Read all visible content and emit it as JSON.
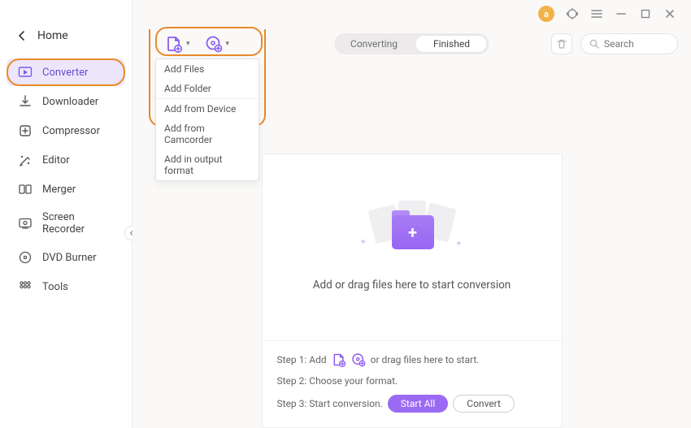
{
  "header": {
    "home_label": "Home",
    "avatar_initial": "a"
  },
  "sidebar": {
    "items": [
      {
        "label": "Converter"
      },
      {
        "label": "Downloader"
      },
      {
        "label": "Compressor"
      },
      {
        "label": "Editor"
      },
      {
        "label": "Merger"
      },
      {
        "label": "Screen Recorder"
      },
      {
        "label": "DVD Burner"
      },
      {
        "label": "Tools"
      }
    ]
  },
  "toolbar": {
    "tabs": {
      "converting": "Converting",
      "finished": "Finished"
    },
    "search_placeholder": "Search"
  },
  "dropdown": {
    "items": [
      "Add Files",
      "Add Folder",
      "Add from Device",
      "Add from Camcorder",
      "Add in output format"
    ]
  },
  "drop": {
    "text": "Add or drag files here to start conversion",
    "step1_pre": "Step 1: Add",
    "step1_post": "or drag files here to start.",
    "step2": "Step 2: Choose your format.",
    "step3": "Step 3: Start conversion.",
    "start_all": "Start All",
    "convert": "Convert"
  }
}
